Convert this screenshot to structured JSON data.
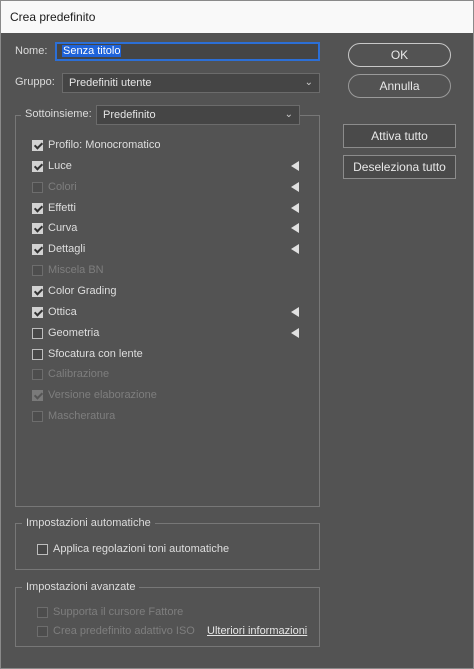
{
  "window": {
    "title": "Crea predefinito"
  },
  "name_field": {
    "label": "Nome:",
    "value": "Senza titolo"
  },
  "group_field": {
    "label": "Gruppo:",
    "value": "Predefiniti utente"
  },
  "subset": {
    "label": "Sottoinsieme:",
    "value": "Predefinito",
    "items": [
      {
        "label": "Profilo: Monocromatico",
        "checked": true,
        "disabled": false,
        "arrow": false
      },
      {
        "label": "Luce",
        "checked": true,
        "disabled": false,
        "arrow": true
      },
      {
        "label": "Colori",
        "checked": false,
        "disabled": true,
        "arrow": true
      },
      {
        "label": "Effetti",
        "checked": true,
        "disabled": false,
        "arrow": true
      },
      {
        "label": "Curva",
        "checked": true,
        "disabled": false,
        "arrow": true
      },
      {
        "label": "Dettagli",
        "checked": true,
        "disabled": false,
        "arrow": true
      },
      {
        "label": "Miscela BN",
        "checked": false,
        "disabled": true,
        "arrow": false
      },
      {
        "label": "Color Grading",
        "checked": true,
        "disabled": false,
        "arrow": false
      },
      {
        "label": "Ottica",
        "checked": true,
        "disabled": false,
        "arrow": true
      },
      {
        "label": "Geometria",
        "checked": false,
        "disabled": false,
        "arrow": true
      },
      {
        "label": "Sfocatura con lente",
        "checked": false,
        "disabled": false,
        "arrow": false
      },
      {
        "label": "Calibrazione",
        "checked": false,
        "disabled": true,
        "arrow": false
      },
      {
        "label": "Versione elaborazione",
        "checked": true,
        "disabled": true,
        "arrow": false
      },
      {
        "label": "Mascheratura",
        "checked": false,
        "disabled": true,
        "arrow": false
      }
    ]
  },
  "buttons": {
    "ok": "OK",
    "cancel": "Annulla",
    "check_all": "Attiva tutto",
    "uncheck_all": "Deseleziona tutto"
  },
  "auto_settings": {
    "title": "Impostazioni automatiche",
    "apply_auto_tone": {
      "label": "Applica regolazioni toni automatiche",
      "checked": false
    }
  },
  "advanced_settings": {
    "title": "Impostazioni avanzate",
    "support_amount": {
      "label": "Supporta il cursore Fattore",
      "checked": false,
      "disabled": true
    },
    "adaptive_preset": {
      "label": "Crea predefinito adattivo ISO",
      "checked": false,
      "disabled": true
    },
    "more_info_link": "Ulteriori informazioni"
  },
  "colors": {
    "dialog_bg": "#535353",
    "selection": "#1f63d9",
    "focus_border": "#2c6fd6"
  }
}
